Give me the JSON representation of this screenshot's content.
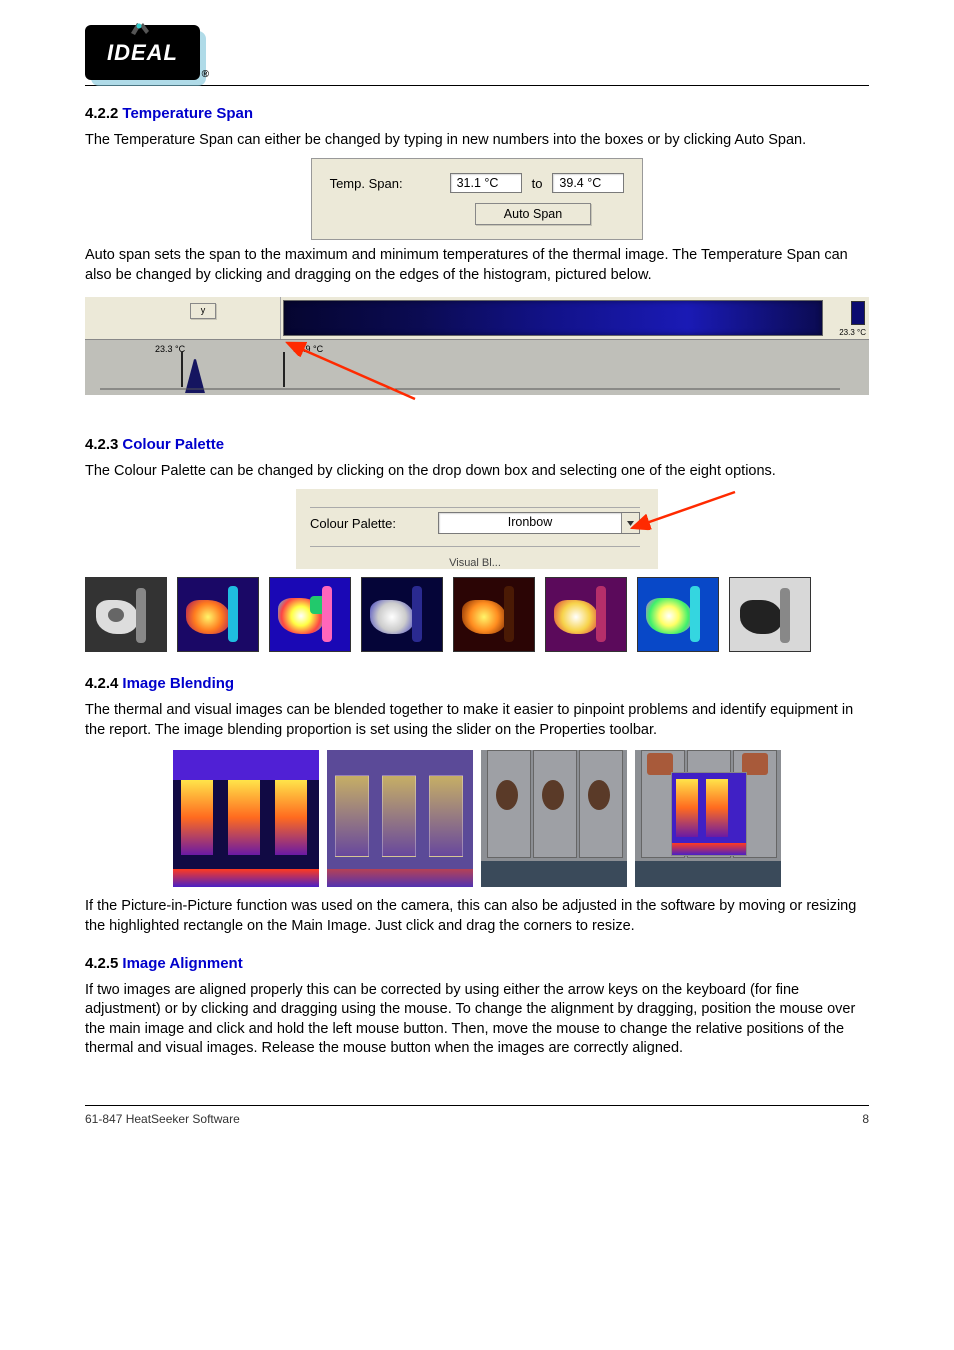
{
  "header": {
    "logo_text": "IDEAL"
  },
  "sections": {
    "temp_span": {
      "number": "4.2.2",
      "title": "Temperature Span",
      "para": "The Temperature Span can either be changed by typing in new numbers into the boxes or by clicking Auto Span."
    },
    "temp_span_panel": {
      "label": "Temp. Span:",
      "from_value": "31.1 °C",
      "to_label": "to",
      "to_value": "39.4 °C",
      "button": "Auto Span"
    },
    "auto_span_text": "Auto span sets the span to the maximum and minimum temperatures of the thermal image. The Temperature Span can also be changed by clicking and dragging on the edges of the histogram, pictured below.",
    "histogram": {
      "y_button": "y",
      "label_left": "23.3 °C",
      "label_right": "31.9 °C",
      "legend_value": "23.3 °C"
    },
    "colour_palette": {
      "number": "4.2.3",
      "title": "Colour Palette",
      "para": "The Colour Palette can be changed by clicking on the drop down box and selecting one of the eight options.",
      "panel_label": "Colour Palette:",
      "panel_value": "Ironbow",
      "truncated_label": "Visual Bl..."
    },
    "image_blending": {
      "number": "4.2.4",
      "title": "Image Blending",
      "para": "The thermal and visual images can be blended together to make it easier to pinpoint problems and identify equipment in the report. The image blending proportion is set using the slider on the Properties toolbar."
    },
    "blending_note": "If the Picture-in-Picture function was used on the camera, this can also be adjusted in the software by moving or resizing the highlighted rectangle on the Main Image. Just click and drag the corners to resize.",
    "image_alignment": {
      "number": "4.2.5",
      "title": "Image Alignment",
      "para": "If two images are aligned properly this can be corrected by using either the arrow keys on the keyboard (for fine adjustment) or by clicking and dragging using the mouse. To change the alignment by dragging, position the mouse over the main image and click and hold the left mouse button. Then, move the mouse to change the relative positions of the thermal and visual images. Release the mouse button when the images are correctly aligned."
    }
  },
  "footer": {
    "left": "61-847 HeatSeeker Software",
    "right": "8"
  }
}
